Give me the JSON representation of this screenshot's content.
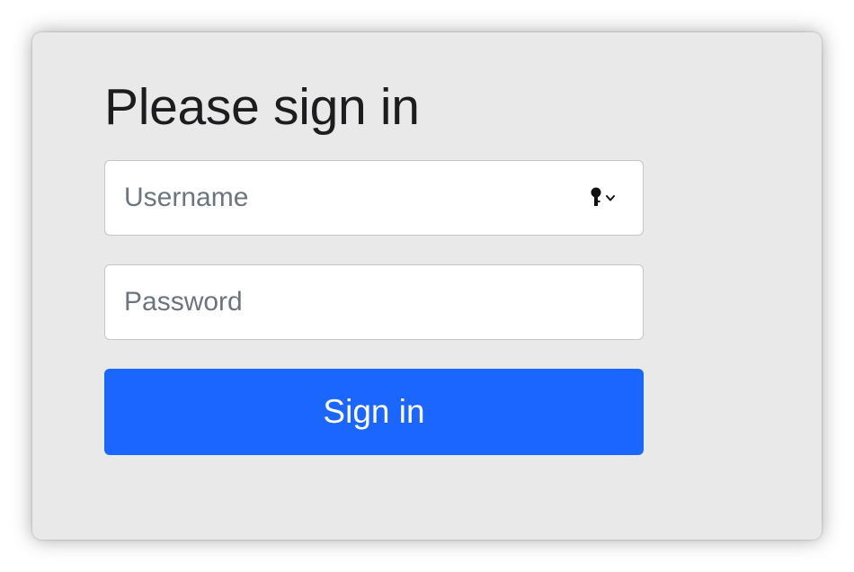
{
  "form": {
    "heading": "Please sign in",
    "username": {
      "placeholder": "Username",
      "value": "",
      "autofill_icon": "key-icon"
    },
    "password": {
      "placeholder": "Password",
      "value": ""
    },
    "submit_label": "Sign in"
  },
  "colors": {
    "panel_background": "#e9e9ea",
    "button_background": "#1a66ff",
    "button_text": "#ffffff",
    "heading_text": "#1d1d1f",
    "placeholder_text": "#6c757d",
    "field_border": "#c6c6c8"
  }
}
